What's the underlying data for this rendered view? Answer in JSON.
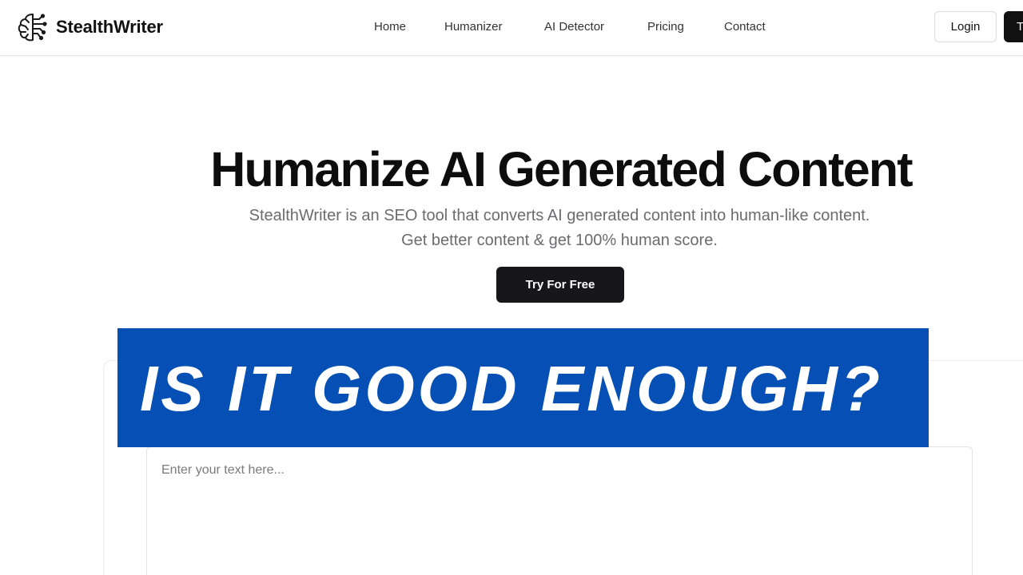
{
  "brand": {
    "name": "StealthWriter",
    "logo_icon": "brain-circuit-icon"
  },
  "nav": {
    "home": "Home",
    "humanizer": "Humanizer",
    "ai_detector": "AI Detector",
    "pricing": "Pricing",
    "contact": "Contact"
  },
  "header_actions": {
    "login": "Login",
    "trial_partial": "T"
  },
  "hero": {
    "title": "Humanize AI Generated Content",
    "subtitle": "StealthWriter is an SEO tool that converts AI generated content into human-like content. Get better content & get 100% human score.",
    "cta": "Try For Free"
  },
  "editor": {
    "placeholder": "Enter your text here...",
    "value": ""
  },
  "overlay": {
    "text": "IS IT GOOD ENOUGH?",
    "background": "#0650b5",
    "color": "#ffffff"
  },
  "colors": {
    "primary_button": "#17161b",
    "text_muted": "#6b6b70"
  }
}
